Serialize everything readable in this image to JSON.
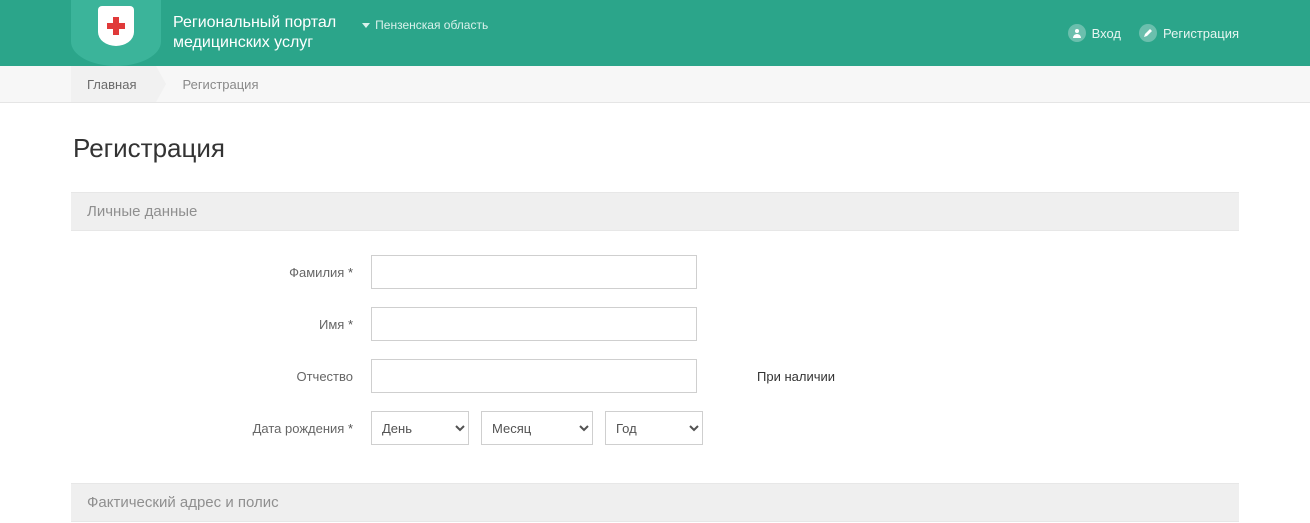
{
  "header": {
    "brand_line1": "Региональный портал",
    "brand_line2": "медицинских услуг",
    "region": "Пензенская область",
    "login": "Вход",
    "register": "Регистрация"
  },
  "crumbs": {
    "home": "Главная",
    "current": "Регистрация"
  },
  "page": {
    "title": "Регистрация"
  },
  "sections": {
    "personal": "Личные данные",
    "address": "Фактический адрес и полис"
  },
  "form": {
    "lastname_label": "Фамилия",
    "firstname_label": "Имя",
    "patronymic_label": "Отчество",
    "patronymic_hint": "При наличии",
    "dob_label": "Дата рождения",
    "day_ph": "День",
    "month_ph": "Месяц",
    "year_ph": "Год"
  }
}
